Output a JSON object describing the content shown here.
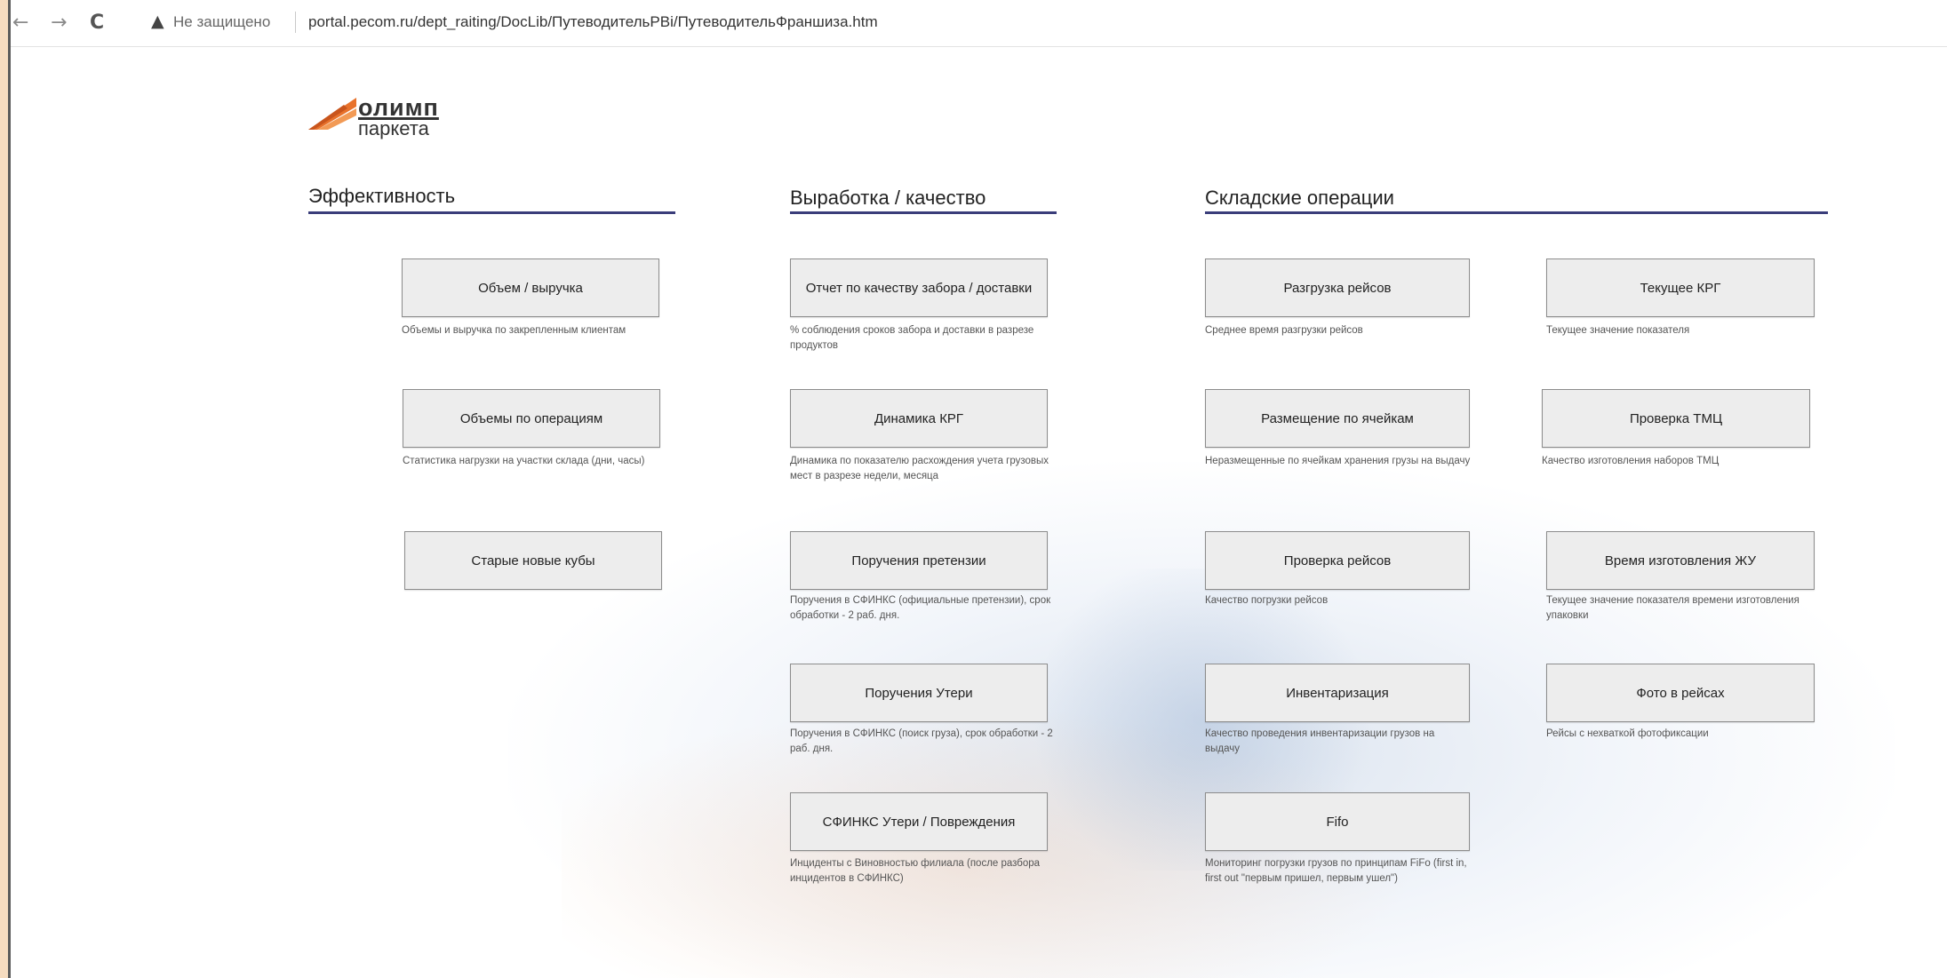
{
  "browser": {
    "back_glyph": "←",
    "forward_glyph": "→",
    "reload_glyph": "C",
    "security_icon": "warning-triangle-icon",
    "security_glyph": "▲",
    "security_text": "Не защищено",
    "url": "portal.pecom.ru/dept_raiting/DocLib/ПутеводительPBi/ПутеводительФраншиза.htm"
  },
  "logo": {
    "line1": "олимп",
    "line2": "паркета"
  },
  "colors": {
    "section_line": "#3a3d7a",
    "tile_bg": "#ededed",
    "tile_border": "#8c8c8c",
    "outer_frame": "#f6dcc0"
  },
  "sections": {
    "efficiency": {
      "title": "Эффективность",
      "tiles": [
        {
          "label": "Объем / выручка",
          "desc": "Объемы и выручка по закрепленным клиентам"
        },
        {
          "label": "Объемы по операциям",
          "desc": "Статистика нагрузки на участки склада (дни, часы)"
        },
        {
          "label": "Старые новые кубы",
          "desc": ""
        }
      ]
    },
    "quality": {
      "title": "Выработка / качество",
      "tiles": [
        {
          "label": "Отчет по качеству забора / доставки",
          "desc": "% соблюдения сроков забора и доставки в разрезе продуктов"
        },
        {
          "label": "Динамика КРГ",
          "desc": "Динамика по показателю расхождения учета грузовых мест в разрезе недели, месяца"
        },
        {
          "label": "Поручения претензии",
          "desc": "Поручения в СФИНКС (официальные претензии), срок обработки - 2 раб. дня."
        },
        {
          "label": "Поручения Утери",
          "desc": "Поручения в СФИНКС (поиск груза), срок обработки - 2 раб. дня."
        },
        {
          "label": "СФИНКС Утери / Повреждения",
          "desc": "Инциденты с Виновностью филиала (после разбора инцидентов в СФИНКС)"
        }
      ]
    },
    "warehouse": {
      "title": "Складские операции",
      "left_tiles": [
        {
          "label": "Разгрузка рейсов",
          "desc": "Среднее время разгрузки рейсов"
        },
        {
          "label": "Размещение по ячейкам",
          "desc": "Неразмещенные по ячейкам хранения грузы на выдачу"
        },
        {
          "label": "Проверка рейсов",
          "desc": "Качество погрузки рейсов"
        },
        {
          "label": "Инвентаризация",
          "desc": "Качество проведения инвентаризации грузов на выдачу"
        },
        {
          "label": "Fifo",
          "desc": "Мониторинг погрузки грузов по принципам FiFo (first in, first out \"первым пришел, первым ушел\")"
        }
      ],
      "right_tiles": [
        {
          "label": "Текущее КРГ",
          "desc": "Текущее значение показателя"
        },
        {
          "label": "Проверка ТМЦ",
          "desc": "Качество изготовления наборов ТМЦ"
        },
        {
          "label": "Время изготовления ЖУ",
          "desc": "Текущее значение показателя времени изготовления упаковки"
        },
        {
          "label": "Фото в рейсах",
          "desc": "Рейсы с нехваткой фотофиксации"
        }
      ]
    }
  }
}
